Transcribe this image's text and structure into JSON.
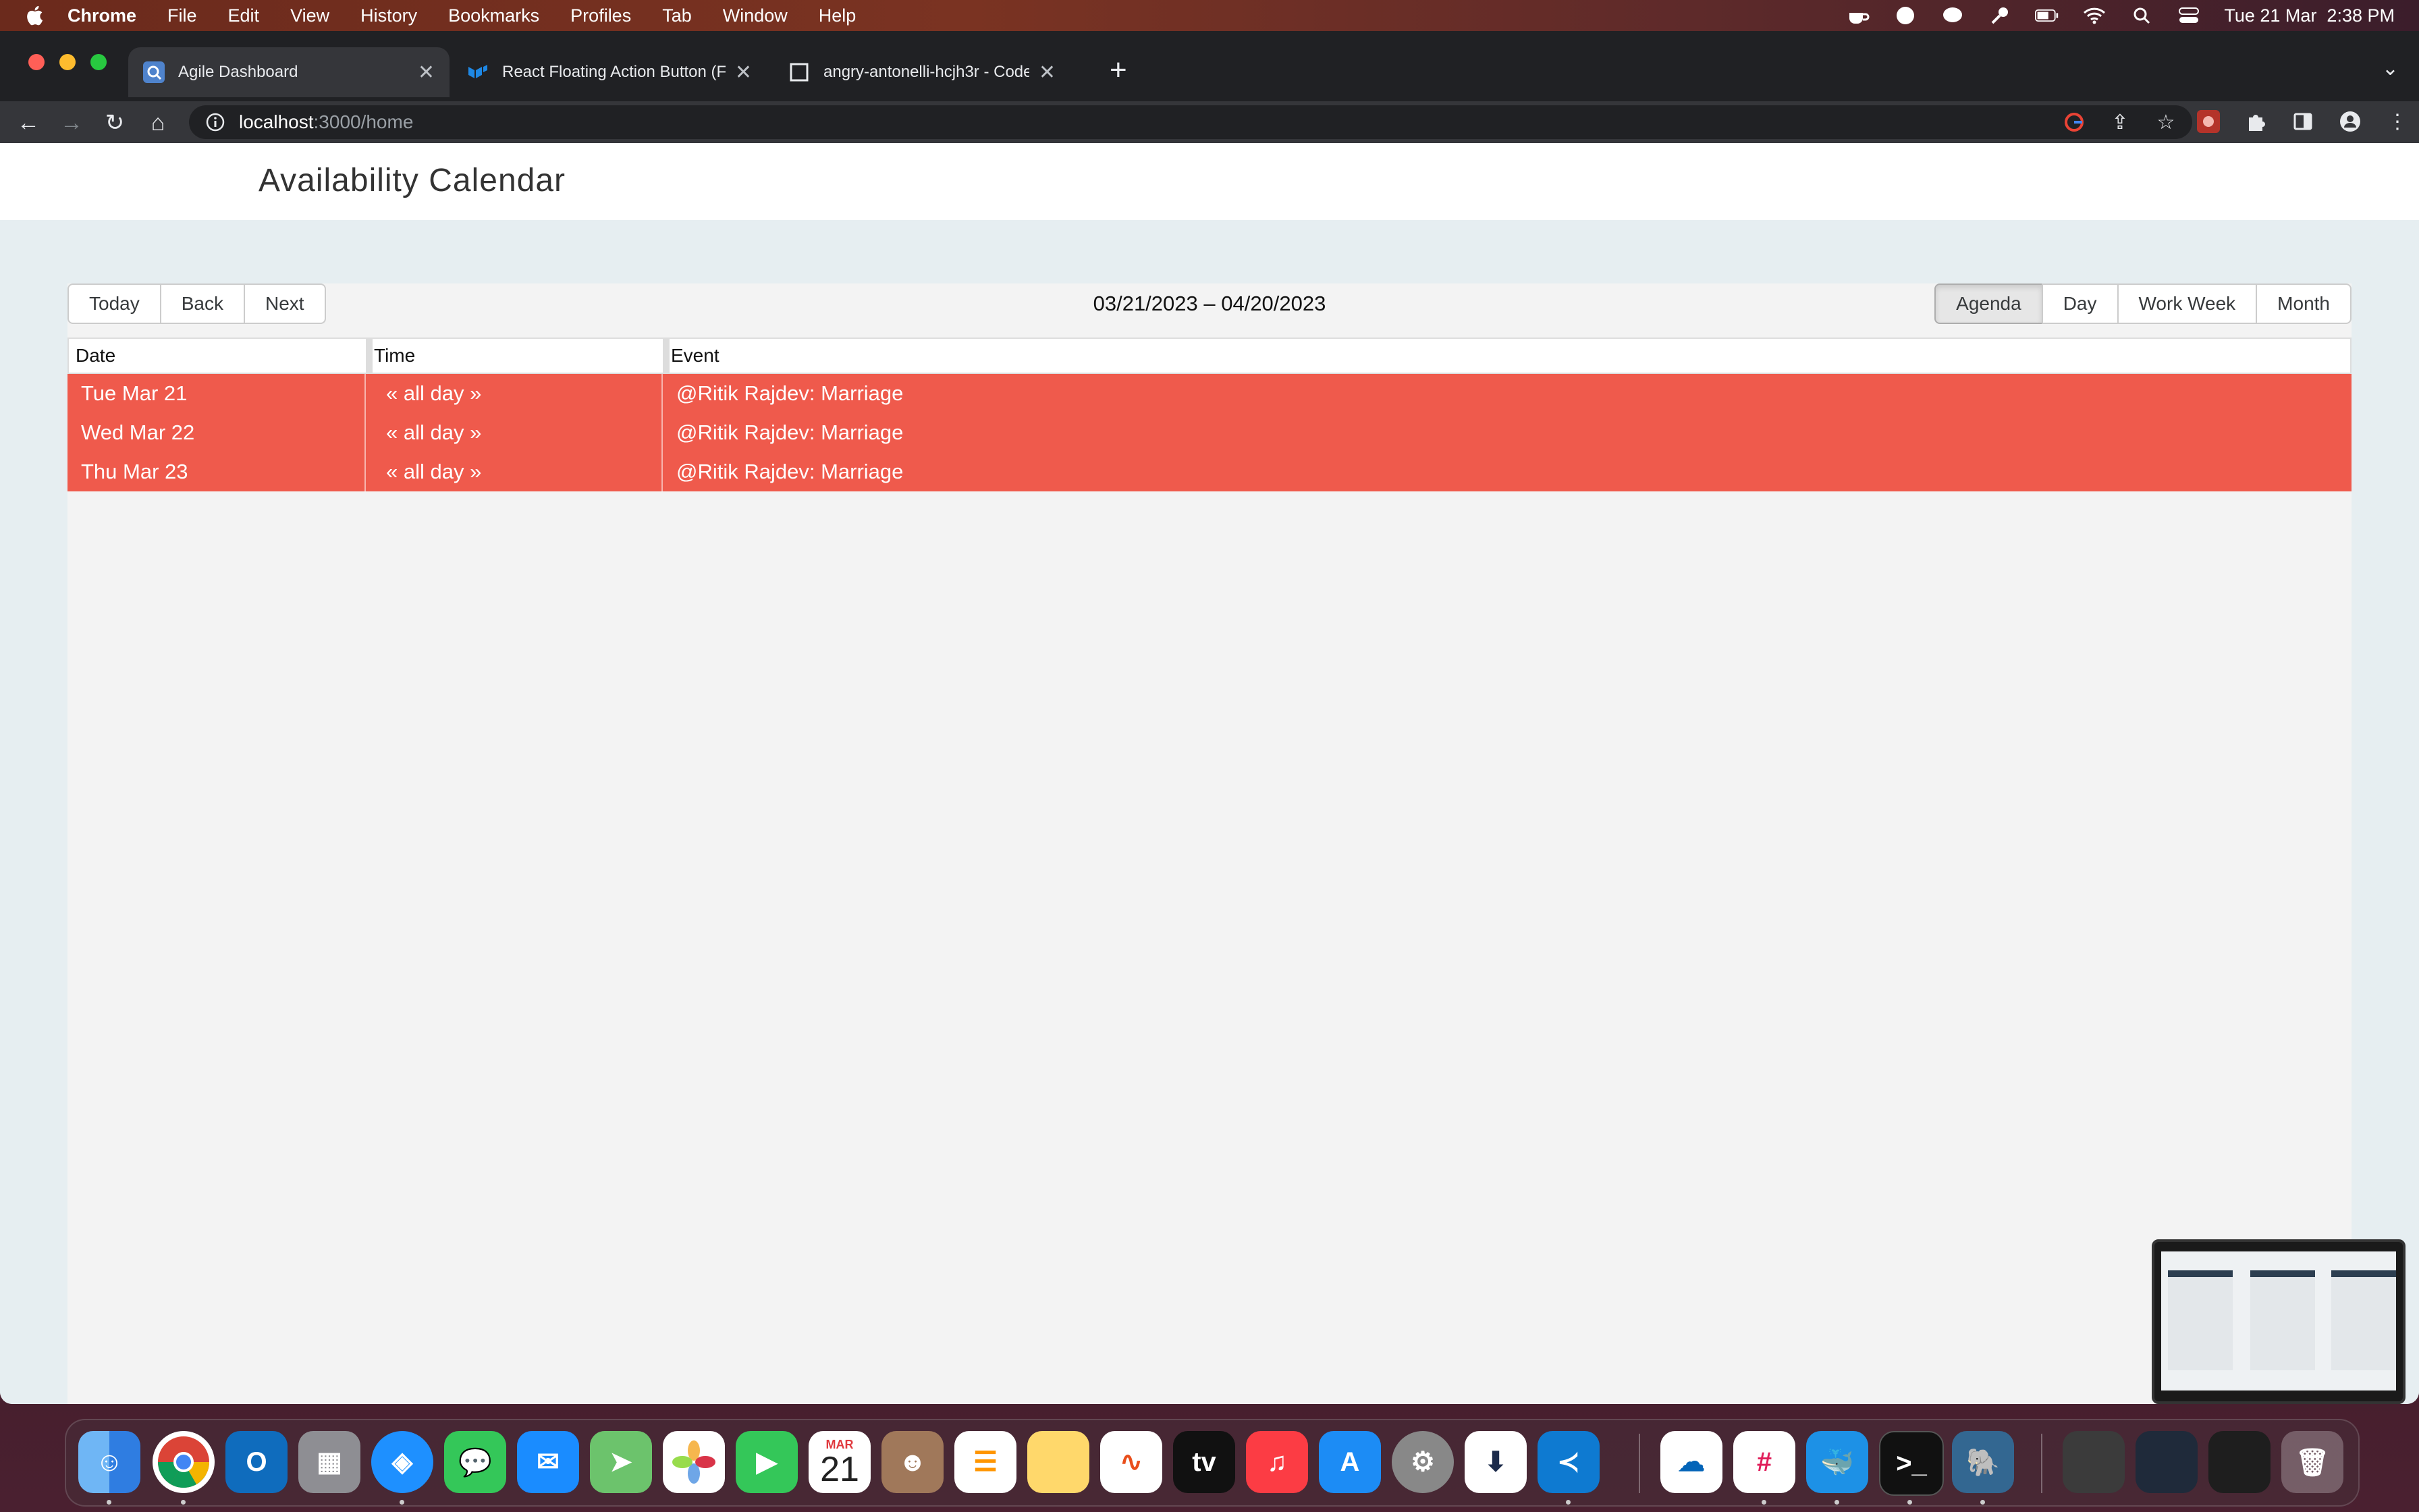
{
  "menubar": {
    "app_name": "Chrome",
    "items": [
      "File",
      "Edit",
      "View",
      "History",
      "Bookmarks",
      "Profiles",
      "Tab",
      "Window",
      "Help"
    ],
    "datetime": "Tue 21 Mar  2:38 PM"
  },
  "browser": {
    "tabs": [
      {
        "title": "Agile Dashboard",
        "active": true
      },
      {
        "title": "React Floating Action Button (F",
        "active": false
      },
      {
        "title": "angry-antonelli-hcjh3r - CodeS",
        "active": false
      }
    ],
    "url_host": "localhost",
    "url_path": ":3000/home"
  },
  "page": {
    "title": "Availability Calendar"
  },
  "calendar": {
    "nav_buttons": {
      "today": "Today",
      "back": "Back",
      "next": "Next"
    },
    "range_label": "03/21/2023 – 04/20/2023",
    "views": {
      "agenda": "Agenda",
      "day": "Day",
      "work_week": "Work Week",
      "month": "Month"
    },
    "active_view": "Agenda",
    "columns": {
      "date": "Date",
      "time": "Time",
      "event": "Event"
    },
    "event_color": "#ef5a4c",
    "rows": [
      {
        "date": "Tue Mar 21",
        "time": "« all day »",
        "event": "@Ritik Rajdev: Marriage"
      },
      {
        "date": "Wed Mar 22",
        "time": "« all day »",
        "event": "@Ritik Rajdev: Marriage"
      },
      {
        "date": "Thu Mar 23",
        "time": "« all day »",
        "event": "@Ritik Rajdev: Marriage"
      }
    ]
  },
  "dock": {
    "calendar_month": "MAR",
    "calendar_day": "21"
  }
}
